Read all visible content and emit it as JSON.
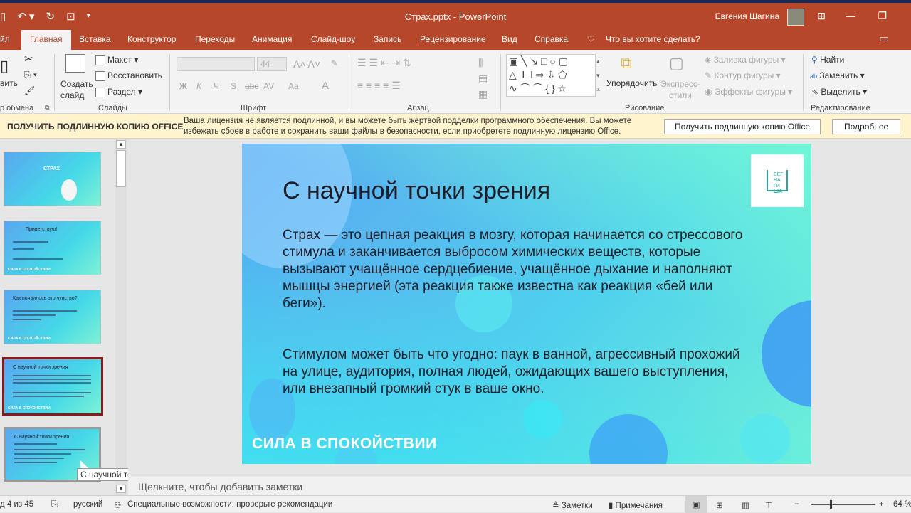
{
  "titlebar": {
    "title": "Страх.pptx  -  PowerPoint",
    "user": "Евгения Шагина",
    "qat": [
      "save-icon",
      "undo-icon",
      "redo-icon",
      "present-icon",
      "customize-icon"
    ]
  },
  "tabs": [
    "йл",
    "Главная",
    "Вставка",
    "Конструктор",
    "Переходы",
    "Анимация",
    "Слайд-шоу",
    "Запись",
    "Рецензирование",
    "Вид",
    "Справка"
  ],
  "tell_me": "Что вы хотите сделать?",
  "ribbon": {
    "clipboard": {
      "paste": "вить",
      "label": "р обмена"
    },
    "slides": {
      "new_slide": "Создать слайд",
      "layout": "Макет",
      "reset": "Восстановить",
      "section": "Раздел",
      "label": "Слайды"
    },
    "font": {
      "size": "44",
      "bold": "Ж",
      "italic": "К",
      "underline": "Ч",
      "strike": "S",
      "abc": "abc",
      "spacing": "AV",
      "case": "Aa",
      "color": "A",
      "label": "Шрифт"
    },
    "paragraph": {
      "label": "Абзац"
    },
    "drawing": {
      "arrange": "Упорядочить",
      "quick_styles": "Экспресс-стили",
      "fill": "Заливка фигуры",
      "outline": "Контур фигуры",
      "effects": "Эффекты фигуры",
      "label": "Рисование"
    },
    "editing": {
      "find": "Найти",
      "replace": "Заменить",
      "select": "Выделить",
      "label": "Редактирование"
    }
  },
  "license": {
    "head": "ПОЛУЧИТЬ ПОДЛИННУЮ КОПИЮ OFFICE",
    "message": "Ваша лицензия не является подлинной, и вы можете быть жертвой подделки программного обеспечения. Вы можете избежать сбоев в работе и сохранить ваши файлы в безопасности, если приобретете подлинную лицензию Office.",
    "get_button": "Получить подлинную копию Office",
    "more_button": "Подробнее"
  },
  "thumbnails": [
    {
      "title": "СТРАХ"
    },
    {
      "title": "Приветствую!"
    },
    {
      "title": "Как появилось это чувство?"
    },
    {
      "title": "С научной точки зрения",
      "selected": true
    },
    {
      "title": "С научной точки зрения"
    }
  ],
  "tooltip": "С научной точки зрения",
  "slide": {
    "title": "С научной точки зрения",
    "para1": "Страх — это цепная реакция в мозгу, которая начинается со стрессового стимула и заканчивается выбросом химических веществ, которые вызывают учащённое сердцебиение, учащённое дыхание и наполняют мышцы энергией (эта реакция также известна как реакция «бей или беги»).",
    "para2": "Стимулом может быть что угодно: паук в ванной, агрессивный прохожий на улице, аудитория, полная людей, ожидающих вашего выступления, или внезапный громкий стук в ваше окно.",
    "footer": "СИЛА В СПОКОЙСТВИИ",
    "logo_text": "БЕГ НА ГИ ША"
  },
  "notes_placeholder": "Щелкните, чтобы добавить заметки",
  "status": {
    "slide": "д 4 из 45",
    "language": "русский",
    "accessibility": "Специальные возможности: проверьте рекомендации",
    "notes": "Заметки",
    "comments": "Примечания",
    "zoom": "64 %",
    "zoom_value": 64
  }
}
